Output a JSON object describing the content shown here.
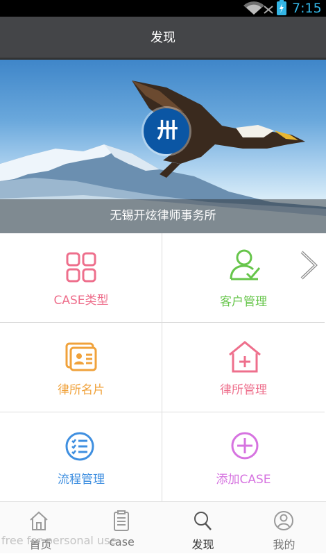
{
  "status": {
    "time": "7:15"
  },
  "header": {
    "title": "发现"
  },
  "banner": {
    "logo_text": "卅",
    "caption": "无锡开炫律师事务所"
  },
  "grid": [
    {
      "label": "CASE类型",
      "icon": "grid-icon",
      "color": "#ee6f8c"
    },
    {
      "label": "客户管理",
      "icon": "user-check-icon",
      "color": "#66c54a"
    },
    {
      "label": "律所名片",
      "icon": "business-card-icon",
      "color": "#f0a23b"
    },
    {
      "label": "律所管理",
      "icon": "house-plus-icon",
      "color": "#ee6f8c"
    },
    {
      "label": "流程管理",
      "icon": "list-check-icon",
      "color": "#3f8fe0"
    },
    {
      "label": "添加CASE",
      "icon": "plus-circle-icon",
      "color": "#d673e0"
    }
  ],
  "tabs": [
    {
      "label": "首页",
      "icon": "home-icon"
    },
    {
      "label": "case",
      "icon": "document-icon"
    },
    {
      "label": "发现",
      "icon": "search-icon",
      "active": true
    },
    {
      "label": "我的",
      "icon": "profile-icon"
    }
  ],
  "watermark": "free for personal use"
}
